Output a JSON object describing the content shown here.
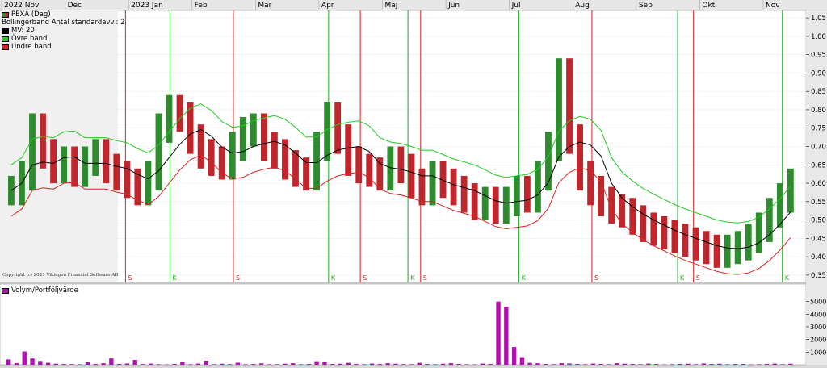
{
  "timeline_labels": [
    "2022 Nov",
    "Dec",
    "2023 Jan",
    "Feb",
    "Mar",
    "Apr",
    "Maj",
    "Jun",
    "Jul",
    "Aug",
    "Sep",
    "Okt",
    "Nov"
  ],
  "legend": {
    "series_name": "PEXA (Dag)",
    "bollinger": "Bollingerband  Antal standardavv.: 2",
    "ma": "MV: 20",
    "upper": "Övre band",
    "lower": "Undre band"
  },
  "volume_legend": "Volym/Portföljvärde",
  "copyright": "Copyright (c) 2023 Vikingen Financial Software AB",
  "colors": {
    "up": "#2e8b2e",
    "down": "#c0262c",
    "ma": "#000000",
    "upper_band": "#22cc22",
    "lower_band": "#dd2020",
    "volume": "#b010b0",
    "background": "#ffffff"
  },
  "chart_data": [
    {
      "type": "candlestick",
      "title": "PEXA (Dag)",
      "ylim": [
        0.33,
        1.07
      ],
      "y_ticks": [
        "0.35",
        "0.40",
        "0.45",
        "0.50",
        "0.55",
        "0.60",
        "0.65",
        "0.70",
        "0.75",
        "0.80",
        "0.85",
        "0.90",
        "0.95",
        "1.00",
        "1.05"
      ],
      "grid": true,
      "signals": [
        {
          "month_pos": 1.85,
          "label": "S"
        },
        {
          "month_pos": 2.55,
          "label": "K"
        },
        {
          "month_pos": 3.55,
          "label": "S"
        },
        {
          "month_pos": 5.05,
          "label": "K"
        },
        {
          "month_pos": 5.55,
          "label": "S"
        },
        {
          "month_pos": 6.3,
          "label": "K"
        },
        {
          "month_pos": 6.5,
          "label": "S"
        },
        {
          "month_pos": 8.05,
          "label": "K"
        },
        {
          "month_pos": 9.2,
          "label": "S"
        },
        {
          "month_pos": 10.55,
          "label": "K"
        },
        {
          "month_pos": 10.8,
          "label": "S"
        },
        {
          "month_pos": 12.2,
          "label": "K"
        }
      ],
      "series": [
        {
          "name": "PEXA (Dag)",
          "close": [
            0.58,
            0.62,
            0.75,
            0.68,
            0.64,
            0.66,
            0.63,
            0.66,
            0.68,
            0.64,
            0.62,
            0.6,
            0.58,
            0.62,
            0.75,
            0.8,
            0.78,
            0.72,
            0.68,
            0.66,
            0.65,
            0.7,
            0.74,
            0.75,
            0.7,
            0.68,
            0.65,
            0.63,
            0.62,
            0.7,
            0.78,
            0.72,
            0.66,
            0.64,
            0.63,
            0.62,
            0.66,
            0.64,
            0.6,
            0.58,
            0.62,
            0.6,
            0.58,
            0.56,
            0.54,
            0.55,
            0.53,
            0.55,
            0.58,
            0.56,
            0.62,
            0.7,
            0.9,
            0.72,
            0.62,
            0.58,
            0.55,
            0.53,
            0.52,
            0.5,
            0.48,
            0.47,
            0.46,
            0.45,
            0.44,
            0.43,
            0.42,
            0.41,
            0.42,
            0.43,
            0.45,
            0.48,
            0.52,
            0.56,
            0.6
          ]
        }
      ]
    },
    {
      "type": "bar",
      "title": "Volym/Portföljvärde",
      "ylim": [
        0,
        6000
      ],
      "y_ticks": [
        "1000'",
        "2000'",
        "3000'",
        "4000'",
        "5000'"
      ],
      "values": [
        420,
        120,
        1050,
        500,
        300,
        150,
        80,
        60,
        50,
        40,
        200,
        60,
        120,
        500,
        60,
        100,
        380,
        50,
        90,
        40,
        30,
        60,
        250,
        40,
        90,
        320,
        40,
        80,
        50,
        160,
        40,
        60,
        110,
        40,
        40,
        80,
        120,
        40,
        60,
        280,
        250,
        60,
        80,
        150,
        60,
        40,
        90,
        60,
        120,
        80,
        50,
        40,
        150,
        60,
        40,
        80,
        120,
        60,
        40,
        30,
        90,
        60,
        5000,
        4600,
        1400,
        600,
        150,
        120,
        60,
        40,
        120,
        100,
        60,
        40,
        90,
        60,
        40,
        120,
        80,
        60,
        40,
        90,
        60,
        30,
        40,
        60,
        80,
        40,
        100,
        60,
        80,
        40,
        60,
        60,
        30,
        40,
        60,
        90,
        40,
        80
      ]
    }
  ]
}
